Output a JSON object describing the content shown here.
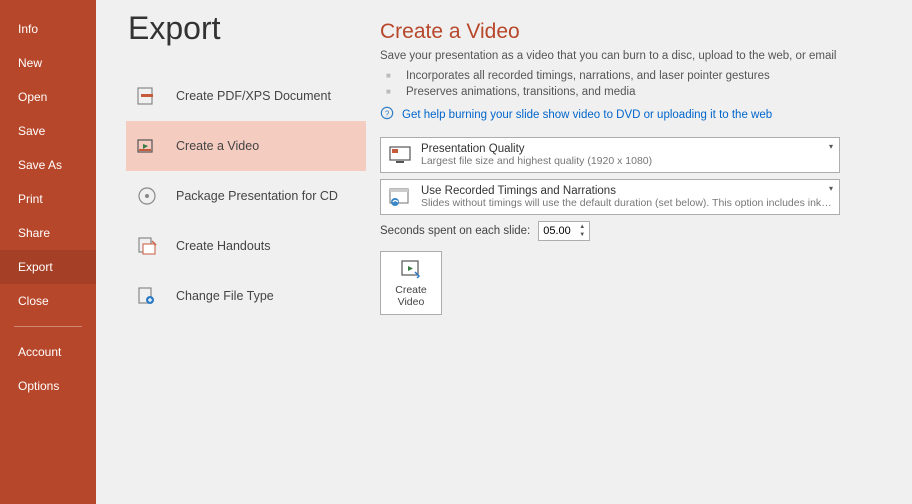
{
  "sidebar": {
    "items": [
      {
        "label": "Info"
      },
      {
        "label": "New"
      },
      {
        "label": "Open"
      },
      {
        "label": "Save"
      },
      {
        "label": "Save As"
      },
      {
        "label": "Print"
      },
      {
        "label": "Share"
      },
      {
        "label": "Export"
      },
      {
        "label": "Close"
      }
    ],
    "account_label": "Account",
    "options_label": "Options"
  },
  "page_title": "Export",
  "export_options": [
    {
      "label": "Create PDF/XPS Document"
    },
    {
      "label": "Create a Video"
    },
    {
      "label": "Package Presentation for CD"
    },
    {
      "label": "Create Handouts"
    },
    {
      "label": "Change File Type"
    }
  ],
  "video": {
    "title": "Create a Video",
    "subtitle": "Save your presentation as a video that you can burn to a disc, upload to the web, or email",
    "bullets": [
      "Incorporates all recorded timings, narrations, and laser pointer gestures",
      "Preserves animations, transitions, and media"
    ],
    "help_link": "Get help burning your slide show video to DVD or uploading it to the web",
    "quality": {
      "title": "Presentation Quality",
      "sub": "Largest file size and highest quality (1920 x 1080)"
    },
    "timings": {
      "title": "Use Recorded Timings and Narrations",
      "sub": "Slides without timings will use the default duration (set below). This option includes ink and las..."
    },
    "seconds_label": "Seconds spent on each slide:",
    "seconds_value": "05.00",
    "create_btn_label": "Create\nVideo"
  }
}
